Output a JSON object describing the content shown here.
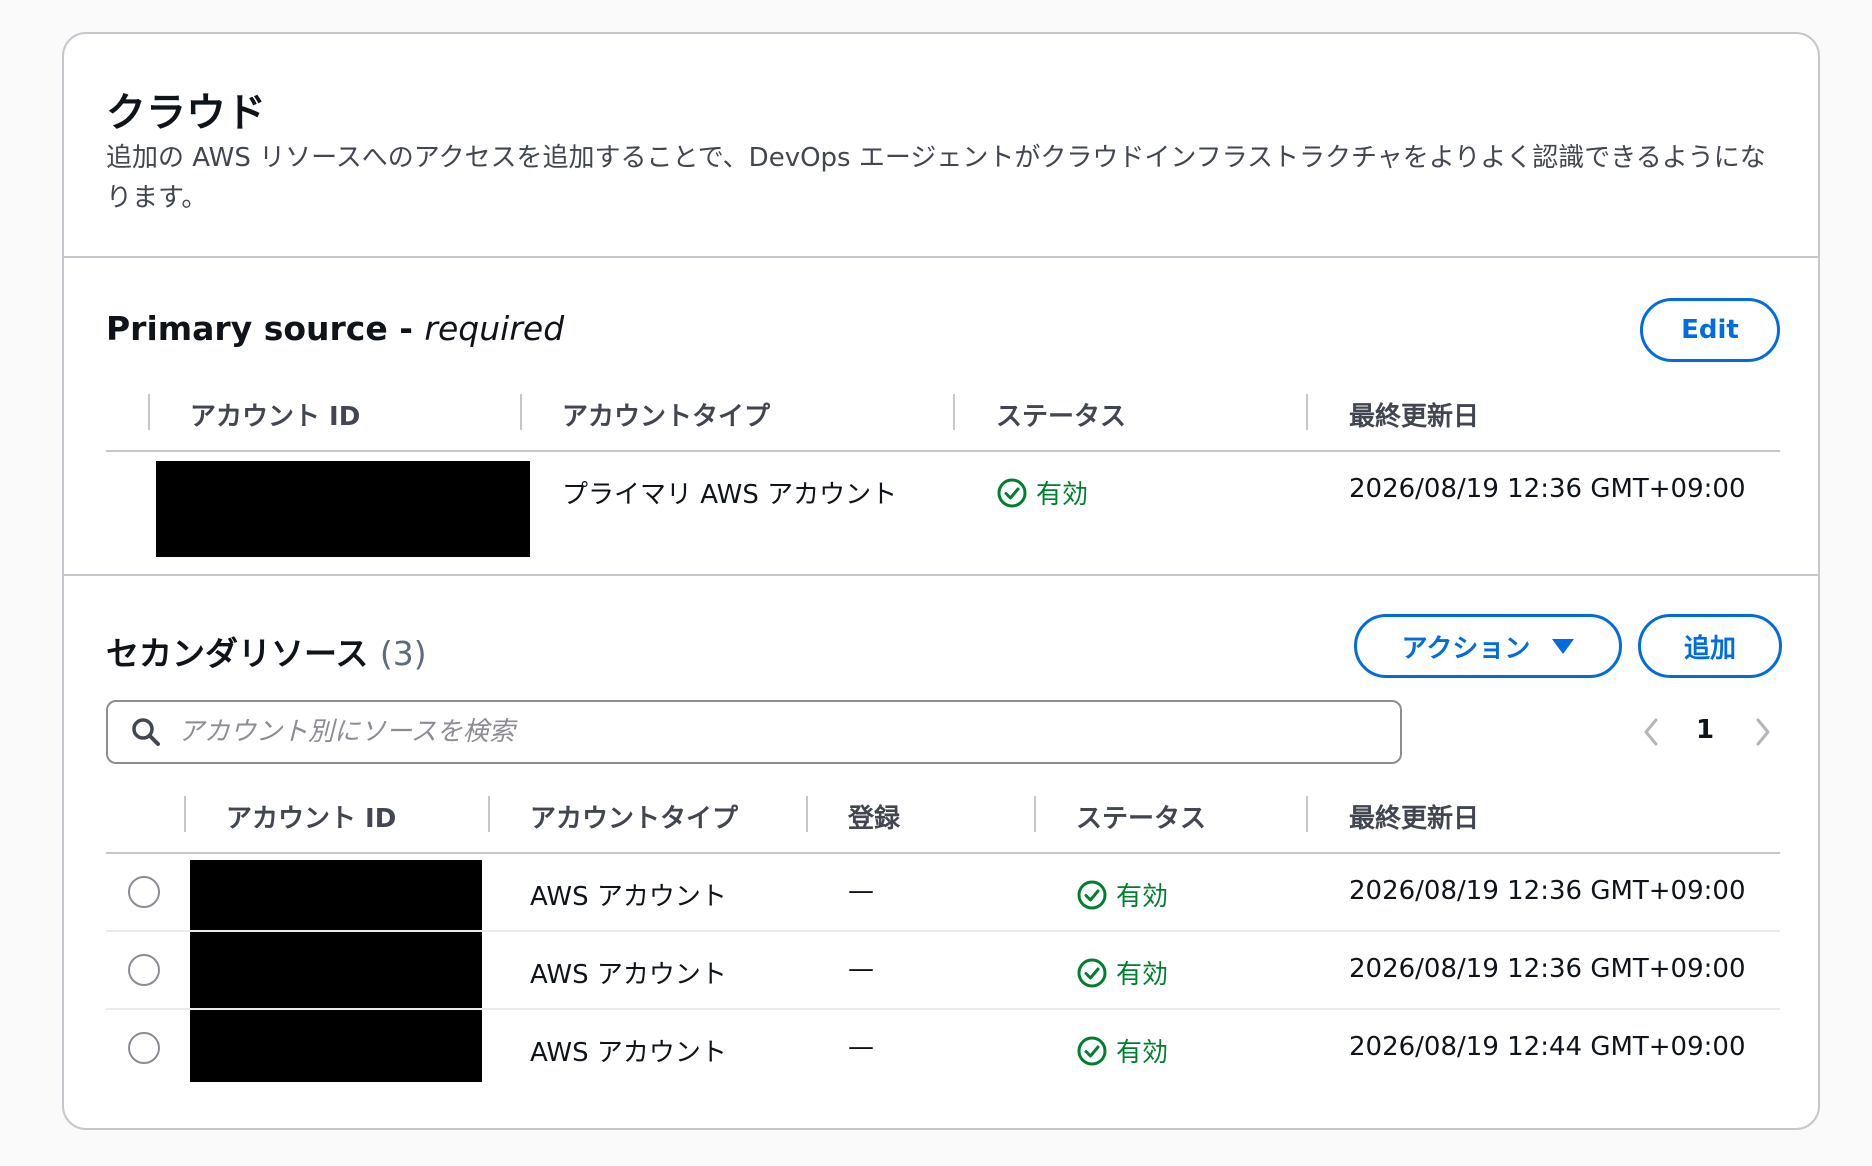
{
  "header": {
    "title": "クラウド",
    "description": "追加の AWS リソースへのアクセスを追加することで、DevOps エージェントがクラウドインフラストラクチャをよりよく認識できるようになります。"
  },
  "primary": {
    "title": "Primary source -",
    "title_suffix": "required",
    "edit_label": "Edit",
    "columns": [
      "アカウント ID",
      "アカウントタイプ",
      "ステータス",
      "最終更新日"
    ],
    "row": {
      "account_type": "プライマリ AWS アカウント",
      "status": "有効",
      "updated": "2026/08/19 12:36 GMT+09:00"
    }
  },
  "secondary": {
    "title": "セカンダリソース",
    "count": "(3)",
    "actions_label": "アクション",
    "add_label": "追加",
    "search_placeholder": "アカウント別にソースを検索",
    "page": "1",
    "columns": [
      "アカウント ID",
      "アカウントタイプ",
      "登録",
      "ステータス",
      "最終更新日"
    ],
    "rows": [
      {
        "account_type": "AWS アカウント",
        "registration": "—",
        "status": "有効",
        "updated": "2026/08/19 12:36 GMT+09:00"
      },
      {
        "account_type": "AWS アカウント",
        "registration": "—",
        "status": "有効",
        "updated": "2026/08/19 12:36 GMT+09:00"
      },
      {
        "account_type": "AWS アカウント",
        "registration": "—",
        "status": "有効",
        "updated": "2026/08/19 12:44 GMT+09:00"
      }
    ]
  },
  "icons": {
    "status": "check-circle-icon",
    "search": "search-icon",
    "actions": "caret-down-icon",
    "prev": "chevron-left-icon",
    "next": "chevron-right-icon"
  },
  "colors": {
    "accent": "#006ce0",
    "success": "#00802f",
    "border": "#c6c6cd",
    "text": "#0f141a"
  }
}
